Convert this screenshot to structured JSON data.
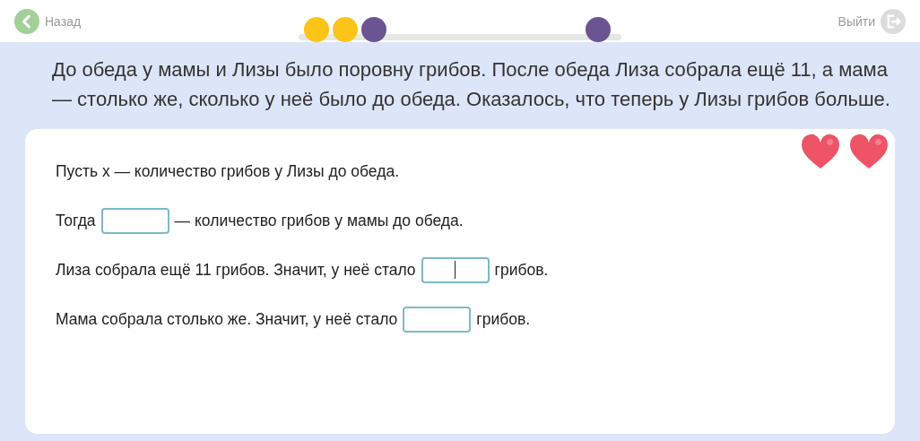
{
  "header": {
    "back": {
      "label": "Назад"
    },
    "exit": {
      "label": "Выйти"
    }
  },
  "progress": {
    "dots": [
      {
        "kind": "step",
        "color": "#fcc419"
      },
      {
        "kind": "step",
        "color": "#fcc419"
      },
      {
        "kind": "step",
        "color": "#6c5391"
      },
      {
        "kind": "goal",
        "color": "#6c5391"
      }
    ]
  },
  "question": "До обеда у мамы и Лизы было поровну грибов. После обеда Лиза собрала ещё 11, а мама — столько же, сколько у неё было до обеда. Оказалось, что теперь у Лизы грибов больше.",
  "lines": [
    {
      "parts": [
        {
          "kind": "text",
          "text": "Пусть x — количество грибов у Лизы до обеда."
        }
      ]
    },
    {
      "parts": [
        {
          "kind": "text",
          "text": "Тогда"
        },
        {
          "kind": "field",
          "focused": false
        },
        {
          "kind": "text",
          "text": "— количество грибов у мамы до обеда."
        }
      ]
    },
    {
      "parts": [
        {
          "kind": "text",
          "text": "Лиза собрала ещё 11 грибов. Значит, у неё стало"
        },
        {
          "kind": "field",
          "focused": true
        },
        {
          "kind": "text",
          "text": "грибов."
        }
      ]
    },
    {
      "parts": [
        {
          "kind": "text",
          "text": "Мама собрала столько же. Значит, у неё стало"
        },
        {
          "kind": "field",
          "focused": false
        },
        {
          "kind": "text",
          "text": "грибов."
        }
      ]
    }
  ]
}
